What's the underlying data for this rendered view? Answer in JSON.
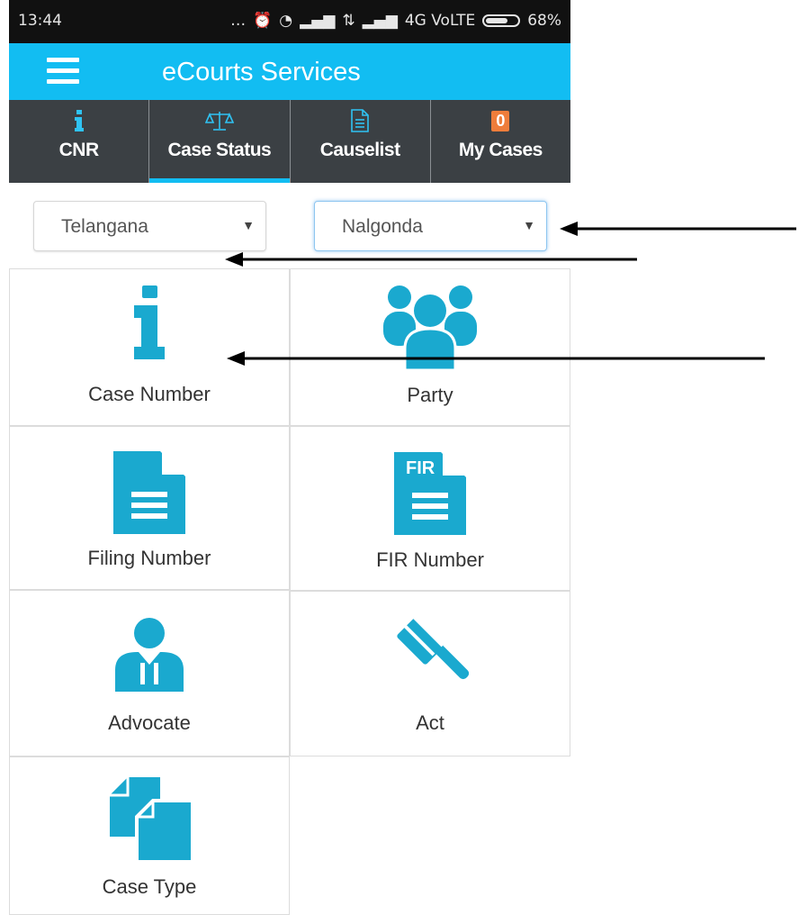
{
  "status_bar": {
    "time": "13:44",
    "network": "4G VoLTE",
    "battery": "68%"
  },
  "app": {
    "title": "eCourts Services"
  },
  "tabs": [
    {
      "label": "CNR",
      "icon": "info-icon"
    },
    {
      "label": "Case Status",
      "icon": "scales-icon",
      "active": true
    },
    {
      "label": "Causelist",
      "icon": "document-icon"
    },
    {
      "label": "My Cases",
      "badge": "0"
    }
  ],
  "filters": {
    "state": "Telangana",
    "district": "Nalgonda"
  },
  "options": [
    {
      "label": "Case Number",
      "icon": "info-icon"
    },
    {
      "label": "Party",
      "icon": "group-icon"
    },
    {
      "label": "Filing Number",
      "icon": "file-icon"
    },
    {
      "label": "FIR Number",
      "icon": "fir-file-icon",
      "icon_text": "FIR"
    },
    {
      "label": "Advocate",
      "icon": "advocate-icon"
    },
    {
      "label": "Act",
      "icon": "gavel-icon"
    },
    {
      "label": "Case Type",
      "icon": "copy-files-icon"
    }
  ],
  "colors": {
    "accent": "#12bdf2",
    "tab_bg": "#3b4044",
    "icon": "#1aa9cf",
    "badge": "#ee7d3b"
  }
}
